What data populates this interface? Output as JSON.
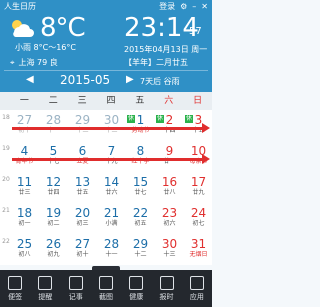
{
  "titlebar": {
    "app": "人生日历",
    "login": "登录"
  },
  "weather": {
    "temp": "8°C",
    "desc": "小雨 8°C～16°C"
  },
  "clock": {
    "time": "23:14",
    "seconds": "57",
    "date": "2015年04月13日 周一",
    "ganzhi": "【羊年】二月廿五"
  },
  "location": {
    "text": "上海 79 良"
  },
  "nav": {
    "prev": "◀",
    "month": "2015-05",
    "next": "▶",
    "days_left": "7天后 谷雨"
  },
  "weekdays": [
    "一",
    "二",
    "三",
    "四",
    "五",
    "六",
    "日"
  ],
  "weeks": [
    {
      "num": "18",
      "cells": [
        {
          "d": "27",
          "l": "初十",
          "other": true
        },
        {
          "d": "28",
          "l": "十一",
          "other": true
        },
        {
          "d": "29",
          "l": "十二",
          "other": true
        },
        {
          "d": "30",
          "l": "十三",
          "other": true
        },
        {
          "d": "1",
          "l": "劳动节",
          "festival": true,
          "rest": "休"
        },
        {
          "d": "2",
          "l": "十四",
          "weekend": true,
          "rest": "休"
        },
        {
          "d": "3",
          "l": "十五",
          "weekend": true,
          "rest": "休"
        }
      ]
    },
    {
      "num": "19",
      "cells": [
        {
          "d": "4",
          "l": "青年节",
          "festival": true
        },
        {
          "d": "5",
          "l": "十七"
        },
        {
          "d": "6",
          "l": "立夏",
          "festival": true
        },
        {
          "d": "7",
          "l": "十九"
        },
        {
          "d": "8",
          "l": "红十字",
          "festival": true
        },
        {
          "d": "9",
          "l": "廿一",
          "weekend": true
        },
        {
          "d": "10",
          "l": "母亲节",
          "weekend": true,
          "festival": true
        }
      ]
    },
    {
      "num": "20",
      "cells": [
        {
          "d": "11",
          "l": "廿三"
        },
        {
          "d": "12",
          "l": "廿四"
        },
        {
          "d": "13",
          "l": "廿五"
        },
        {
          "d": "14",
          "l": "廿六"
        },
        {
          "d": "15",
          "l": "廿七"
        },
        {
          "d": "16",
          "l": "廿八",
          "weekend": true
        },
        {
          "d": "17",
          "l": "廿九",
          "weekend": true
        }
      ]
    },
    {
      "num": "21",
      "cells": [
        {
          "d": "18",
          "l": "初一"
        },
        {
          "d": "19",
          "l": "初二"
        },
        {
          "d": "20",
          "l": "初三"
        },
        {
          "d": "21",
          "l": "小满"
        },
        {
          "d": "22",
          "l": "初五"
        },
        {
          "d": "23",
          "l": "初六",
          "weekend": true
        },
        {
          "d": "24",
          "l": "初七",
          "weekend": true
        }
      ]
    },
    {
      "num": "22",
      "cells": [
        {
          "d": "25",
          "l": "初八"
        },
        {
          "d": "26",
          "l": "初九"
        },
        {
          "d": "27",
          "l": "初十"
        },
        {
          "d": "28",
          "l": "十一"
        },
        {
          "d": "29",
          "l": "十二"
        },
        {
          "d": "30",
          "l": "十三",
          "weekend": true
        },
        {
          "d": "31",
          "l": "无烟日",
          "weekend": true,
          "festival": true
        }
      ]
    }
  ],
  "toolbar": [
    {
      "label": "便签",
      "icon": "note-icon"
    },
    {
      "label": "提醒",
      "icon": "alarm-icon"
    },
    {
      "label": "记事",
      "icon": "diary-icon"
    },
    {
      "label": "截图",
      "icon": "screenshot-icon"
    },
    {
      "label": "健康",
      "icon": "health-icon"
    },
    {
      "label": "报时",
      "icon": "chime-icon"
    },
    {
      "label": "应用",
      "icon": "apps-icon"
    }
  ],
  "colors": {
    "header": "#2f90c6",
    "weekend": "#e0302f",
    "rest_badge": "#2bb24c",
    "arrow": "#e02d2d"
  }
}
